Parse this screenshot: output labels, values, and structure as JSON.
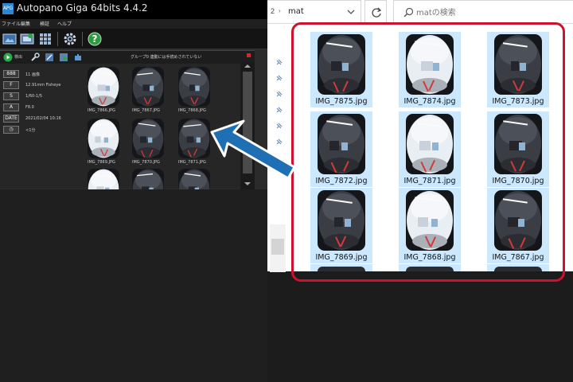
{
  "autopano": {
    "logo": "APG",
    "title": "Autopano Giga 64bits 4.4.2",
    "menus": [
      "ファイル",
      "編集",
      "検証",
      "ヘルプ"
    ],
    "toolbar_icons": [
      "open-images-icon",
      "import-folder-icon",
      "detect-grid-icon",
      "settings-gear-icon",
      "help-icon"
    ],
    "group": {
      "label": "グループ0  連動には手続めされていない",
      "info": [
        {
          "key": "888",
          "value": "11 画像"
        },
        {
          "key": "F",
          "value": "12.91mm Fisheye"
        },
        {
          "key": "S",
          "value": "1/60-1/5"
        },
        {
          "key": "A",
          "value": "F8.0"
        },
        {
          "key": "DATE",
          "value": "2021/02/04 10:16"
        },
        {
          "key": "◷",
          "value": "<1分"
        }
      ],
      "thumbs": [
        "IMG_7866.JPG",
        "IMG_7867.JPG",
        "IMG_7868.JPG",
        "IMG_7869.JPG",
        "IMG_7870.JPG",
        "IMG_7871.JPG",
        "",
        "",
        ""
      ]
    }
  },
  "explorer": {
    "address": {
      "prev": "2",
      "separator": "›",
      "current": "mat"
    },
    "search": {
      "placeholder": "matの検索"
    },
    "files": [
      "IMG_7875.jpg",
      "IMG_7874.jpg",
      "IMG_7873.jpg",
      "IMG_7872.jpg",
      "IMG_7871.jpg",
      "IMG_7870.jpg",
      "IMG_7869.jpg",
      "IMG_7868.jpg",
      "IMG_7867.jpg"
    ]
  },
  "colors": {
    "highlight": "#d0112b",
    "arrow": "#1f6fb4",
    "selection": "#cce8ff",
    "autopano_bg": "#2b2b2b"
  }
}
